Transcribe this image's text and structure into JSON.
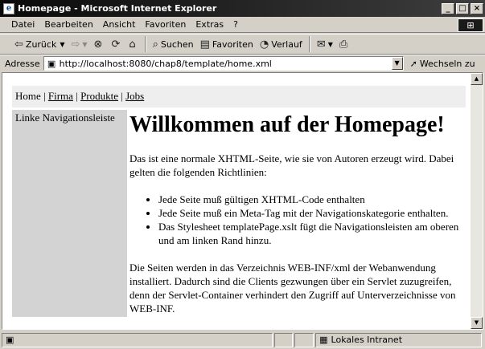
{
  "window": {
    "title": "Homepage - Microsoft Internet Explorer"
  },
  "menu": [
    "Datei",
    "Bearbeiten",
    "Ansicht",
    "Favoriten",
    "Extras",
    "?"
  ],
  "toolbar": {
    "back": "Zurück",
    "search": "Suchen",
    "favorites": "Favoriten",
    "history": "Verlauf"
  },
  "address": {
    "label": "Adresse",
    "url": "http://localhost:8080/chap8/template/home.xml",
    "go": "Wechseln zu"
  },
  "page": {
    "topnav": {
      "home": "Home",
      "sep1": " | ",
      "firma": "Firma",
      "sep2": " | ",
      "produkte": "Produkte",
      "sep3": " | ",
      "jobs": "Jobs"
    },
    "sidenav": "Linke Navigationsleiste",
    "heading": "Willkommen auf der Homepage!",
    "intro": "Das ist eine normale XHTML-Seite, wie sie von Autoren erzeugt wird. Dabei gelten die folgenden Richtlinien:",
    "rules": [
      "Jede Seite muß gültigen XHTML-Code enthalten",
      "Jede Seite muß ein Meta-Tag mit der Navigationskategorie enthalten.",
      "Das Stylesheet templatePage.xslt fügt die Navigationsleisten am oberen und am linken Rand hinzu."
    ],
    "outro": "Die Seiten werden in das Verzeichnis WEB-INF/xml der Webanwendung installiert. Dadurch sind die Clients gezwungen über ein Servlet zuzugreifen, denn der Servlet-Container verhindert den Zugriff auf Unterverzeichnisse von WEB-INF."
  },
  "status": {
    "zone": "Lokales Intranet"
  }
}
